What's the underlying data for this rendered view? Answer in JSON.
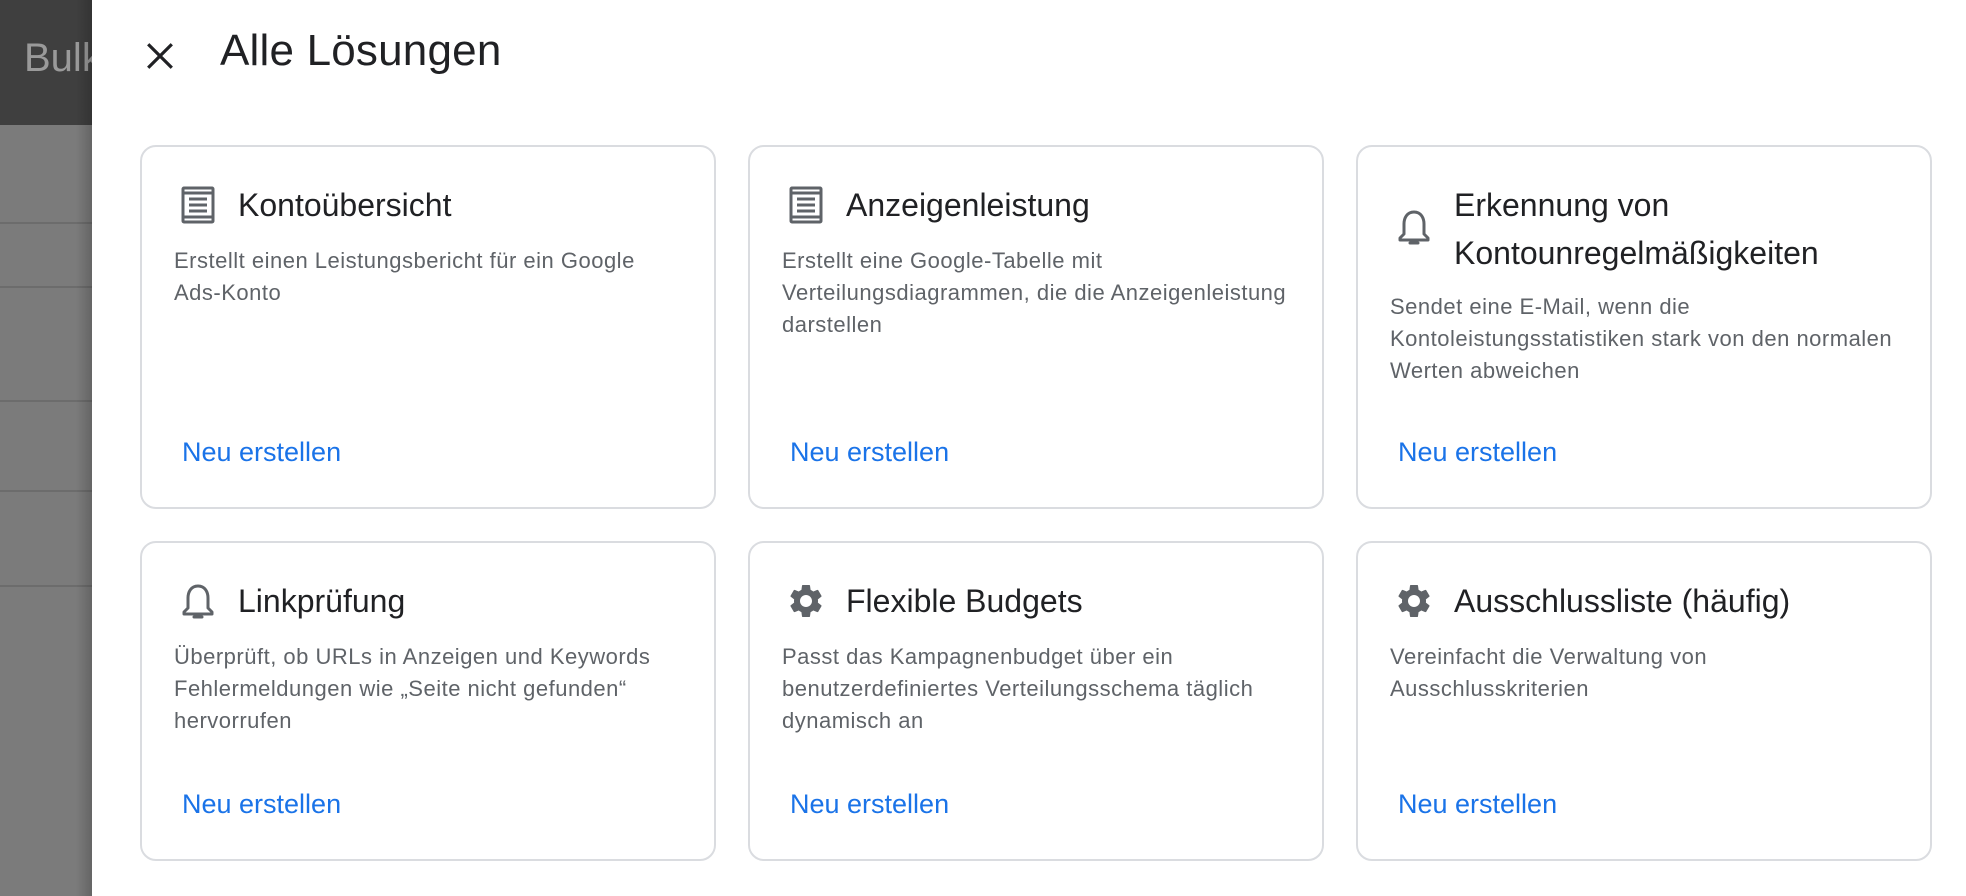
{
  "background": {
    "app_title": "Bulk"
  },
  "header": {
    "title": "Alle Lösungen",
    "close_icon": "close-icon"
  },
  "cards": [
    {
      "icon": "document-icon",
      "title": "Kontoübersicht",
      "description": "Erstellt einen Leistungsbericht für ein Google Ads-Konto",
      "action": "Neu erstellen"
    },
    {
      "icon": "document-icon",
      "title": "Anzeigenleistung",
      "description": "Erstellt eine Google-Tabelle mit Verteilungsdiagrammen, die die Anzeigenleistung darstellen",
      "action": "Neu erstellen"
    },
    {
      "icon": "bell-icon",
      "title": "Erkennung von Kontounregelmäßigkeiten",
      "description": "Sendet eine E-Mail, wenn die Kontoleistungsstatistiken stark von den normalen Werten abweichen",
      "action": "Neu erstellen"
    },
    {
      "icon": "bell-icon",
      "title": "Linkprüfung",
      "description": "Überprüft, ob URLs in Anzeigen und Keywords Fehlermeldungen wie „Seite nicht gefunden“ hervorrufen",
      "action": "Neu erstellen"
    },
    {
      "icon": "gear-icon",
      "title": "Flexible Budgets",
      "description": "Passt das Kampagnenbudget über ein benutzerdefiniertes Verteilungsschema täglich dynamisch an",
      "action": "Neu erstellen"
    },
    {
      "icon": "gear-icon",
      "title": "Ausschlussliste (häufig)",
      "description": "Vereinfacht die Verwaltung von Ausschlusskriterien",
      "action": "Neu erstellen"
    }
  ],
  "colors": {
    "accent": "#1a73e8",
    "title_text": "#202124",
    "body_text": "#5f6368",
    "card_border": "#dadce0"
  }
}
